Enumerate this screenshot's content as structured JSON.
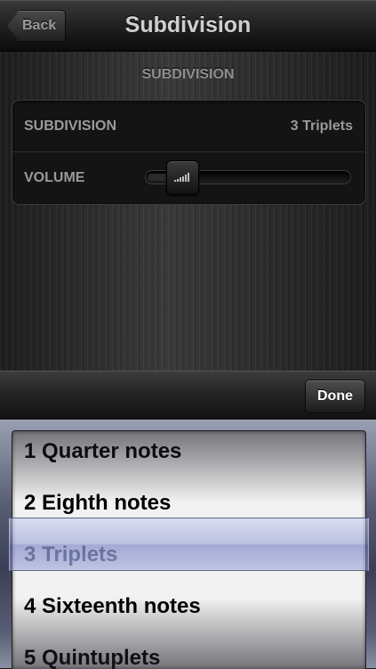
{
  "nav": {
    "back_label": "Back",
    "title": "Subdivision"
  },
  "settings": {
    "section_header": "SUBDIVISION",
    "rows": [
      {
        "label": "SUBDIVISION",
        "value": "3 Triplets"
      },
      {
        "label": "VOLUME",
        "level": 0.12
      }
    ]
  },
  "toolbar": {
    "done_label": "Done"
  },
  "picker": {
    "options": [
      "1 Quarter notes",
      "2 Eighth notes",
      "3 Triplets",
      "4 Sixteenth notes",
      "5 Quintuplets"
    ],
    "selected": "3 Triplets"
  }
}
